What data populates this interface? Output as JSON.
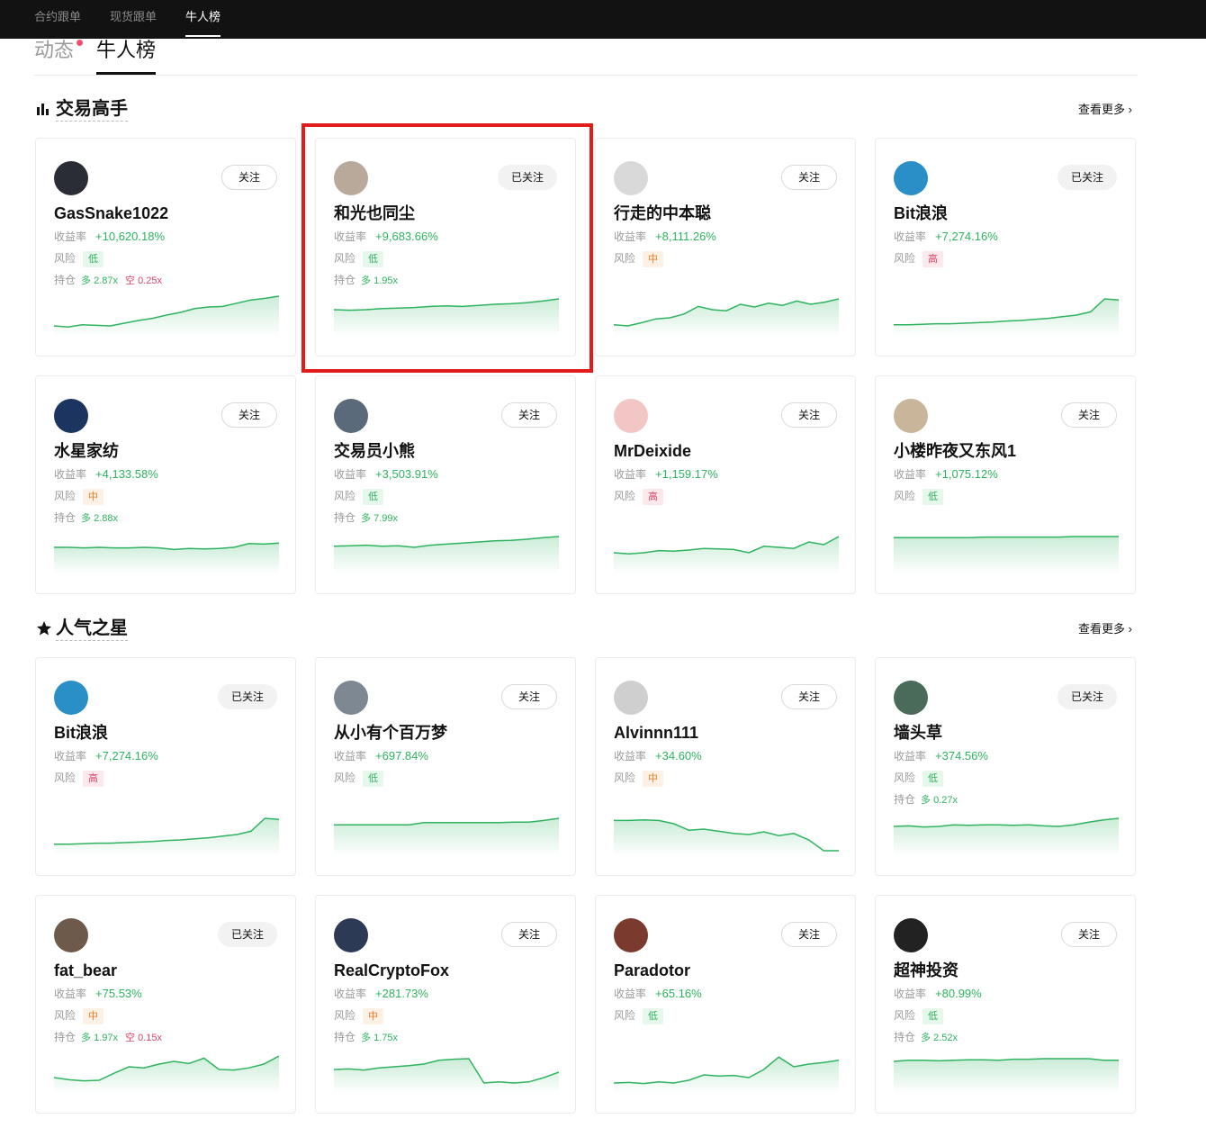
{
  "topnav": [
    {
      "label": "合约跟单",
      "active": false
    },
    {
      "label": "现货跟单",
      "active": false
    },
    {
      "label": "牛人榜",
      "active": true
    }
  ],
  "subtabs": {
    "dynamic": "动态",
    "ranking": "牛人榜"
  },
  "labels": {
    "roi": "收益率",
    "risk": "风险",
    "position": "持仓",
    "long": "多",
    "short": "空"
  },
  "colors": {
    "profit": "#2eb35f",
    "highlight_box": "#e21b1b"
  },
  "sections": [
    {
      "title": "交易高手",
      "icon": "bar-chart-icon",
      "see_more": "查看更多",
      "traders": [
        {
          "name": "GasSnake1022",
          "follow": "关注",
          "followed": false,
          "roi": "+10,620.18%",
          "risk": "低",
          "risk_level": "low",
          "long": "2.87x",
          "short": "0.25x",
          "avatar_icon": "dark-disc-avatar",
          "trend": [
            0.2,
            0.18,
            0.22,
            0.21,
            0.2,
            0.25,
            0.3,
            0.34,
            0.4,
            0.45,
            0.52,
            0.55,
            0.56,
            0.62,
            0.68,
            0.71,
            0.75
          ]
        },
        {
          "name": "和光也同尘",
          "follow": "已关注",
          "followed": true,
          "roi": "+9,683.66%",
          "risk": "低",
          "risk_level": "low",
          "long": "1.95x",
          "short": null,
          "avatar_icon": "person-photo-avatar",
          "trend": [
            0.5,
            0.49,
            0.5,
            0.52,
            0.53,
            0.54,
            0.56,
            0.57,
            0.56,
            0.58,
            0.6,
            0.61,
            0.63,
            0.66,
            0.7
          ]
        },
        {
          "name": "行走的中本聪",
          "follow": "关注",
          "followed": false,
          "roi": "+8,111.26%",
          "risk": "中",
          "risk_level": "mid",
          "long": null,
          "short": null,
          "avatar_icon": "cartoon-panda-avatar",
          "trend": [
            0.22,
            0.2,
            0.26,
            0.33,
            0.35,
            0.42,
            0.56,
            0.5,
            0.48,
            0.6,
            0.55,
            0.62,
            0.58,
            0.66,
            0.6,
            0.64,
            0.7
          ]
        },
        {
          "name": "Bit浪浪",
          "follow": "已关注",
          "followed": true,
          "roi": "+7,274.16%",
          "risk": "高",
          "risk_level": "high",
          "long": null,
          "short": null,
          "avatar_icon": "wave-avatar",
          "trend": [
            0.22,
            0.22,
            0.23,
            0.24,
            0.24,
            0.25,
            0.26,
            0.27,
            0.29,
            0.3,
            0.32,
            0.34,
            0.37,
            0.4,
            0.46,
            0.7,
            0.68
          ]
        }
      ]
    },
    {
      "title": "人气之星",
      "icon": "star-icon",
      "see_more": "查看更多",
      "traders": [
        {
          "name": "Bit浪浪",
          "follow": "已关注",
          "followed": true,
          "roi": "+7,274.16%",
          "risk": "高",
          "risk_level": "high",
          "long": null,
          "short": null,
          "avatar_icon": "wave-avatar",
          "trend": [
            0.22,
            0.22,
            0.23,
            0.24,
            0.24,
            0.25,
            0.26,
            0.27,
            0.29,
            0.3,
            0.32,
            0.34,
            0.37,
            0.4,
            0.46,
            0.7,
            0.68
          ]
        }
      ]
    }
  ],
  "grid_rows": [
    {
      "section": 0,
      "traders": [
        {
          "name": "水星家纺",
          "follow": "关注",
          "followed": false,
          "roi": "+4,133.58%",
          "risk": "中",
          "risk_level": "mid",
          "long": "2.88x",
          "short": null,
          "avatar_icon": "bitcoin-avatar",
          "trend": [
            0.5,
            0.5,
            0.49,
            0.5,
            0.49,
            0.49,
            0.5,
            0.49,
            0.46,
            0.48,
            0.47,
            0.48,
            0.5,
            0.57,
            0.56,
            0.58
          ]
        },
        {
          "name": "交易员小熊",
          "follow": "关注",
          "followed": false,
          "roi": "+3,503.91%",
          "risk": "低",
          "risk_level": "low",
          "long": "7.99x",
          "short": null,
          "avatar_icon": "glasses-person-avatar",
          "trend": [
            0.52,
            0.53,
            0.54,
            0.52,
            0.53,
            0.5,
            0.54,
            0.56,
            0.58,
            0.6,
            0.62,
            0.63,
            0.65,
            0.68,
            0.7
          ]
        },
        {
          "name": "MrDeixide",
          "follow": "关注",
          "followed": false,
          "roi": "+1,159.17%",
          "risk": "高",
          "risk_level": "high",
          "long": null,
          "short": null,
          "avatar_icon": "cartoon-kid-avatar",
          "trend": [
            0.4,
            0.38,
            0.4,
            0.44,
            0.43,
            0.45,
            0.48,
            0.47,
            0.46,
            0.4,
            0.52,
            0.5,
            0.48,
            0.6,
            0.55,
            0.7
          ]
        },
        {
          "name": "小楼昨夜又东风1",
          "follow": "关注",
          "followed": false,
          "roi": "+1,075.12%",
          "risk": "低",
          "risk_level": "low",
          "long": null,
          "short": null,
          "avatar_icon": "glasses-face-avatar",
          "trend": [
            0.68,
            0.68,
            0.68,
            0.68,
            0.68,
            0.68,
            0.69,
            0.69,
            0.69,
            0.69,
            0.69,
            0.69,
            0.7,
            0.7,
            0.7,
            0.7
          ]
        }
      ]
    },
    {
      "section": 1,
      "traders": [
        {
          "name": "从小有个百万梦",
          "follow": "关注",
          "followed": false,
          "roi": "+697.84%",
          "risk": "低",
          "risk_level": "low",
          "long": null,
          "short": null,
          "avatar_icon": "landscape-avatar",
          "trend": [
            0.58,
            0.58,
            0.58,
            0.58,
            0.58,
            0.58,
            0.62,
            0.62,
            0.62,
            0.62,
            0.62,
            0.62,
            0.63,
            0.63,
            0.66,
            0.7
          ]
        },
        {
          "name": "Alvinnn111",
          "follow": "关注",
          "followed": false,
          "roi": "+34.60%",
          "risk": "中",
          "risk_level": "mid",
          "long": null,
          "short": null,
          "avatar_icon": "dancer-avatar",
          "trend": [
            0.66,
            0.66,
            0.67,
            0.66,
            0.6,
            0.48,
            0.5,
            0.46,
            0.42,
            0.4,
            0.45,
            0.38,
            0.42,
            0.3,
            0.1,
            0.1
          ]
        },
        {
          "name": "墙头草",
          "follow": "已关注",
          "followed": true,
          "roi": "+374.56%",
          "risk": "低",
          "risk_level": "low",
          "long": "0.27x",
          "short": null,
          "avatar_icon": "frog-avatar",
          "trend": [
            0.55,
            0.56,
            0.54,
            0.55,
            0.58,
            0.57,
            0.58,
            0.58,
            0.57,
            0.58,
            0.56,
            0.55,
            0.58,
            0.63,
            0.67,
            0.7
          ]
        },
        {
          "name": "fat_bear",
          "follow": "已关注",
          "followed": true,
          "roi": "+75.53%",
          "risk": "中",
          "risk_level": "mid",
          "long": "1.97x",
          "short": "0.15x",
          "avatar_icon": "bear-avatar",
          "trend": [
            0.3,
            0.26,
            0.24,
            0.25,
            0.38,
            0.5,
            0.48,
            0.55,
            0.6,
            0.56,
            0.66,
            0.45,
            0.44,
            0.48,
            0.55,
            0.7
          ]
        },
        {
          "name": "RealCryptoFox",
          "follow": "关注",
          "followed": false,
          "roi": "+281.73%",
          "risk": "中",
          "risk_level": "mid",
          "long": "1.75x",
          "short": null,
          "avatar_icon": "suit-person-avatar",
          "trend": [
            0.45,
            0.46,
            0.44,
            0.48,
            0.5,
            0.52,
            0.55,
            0.62,
            0.64,
            0.65,
            0.2,
            0.22,
            0.2,
            0.22,
            0.3,
            0.4
          ]
        },
        {
          "name": "Paradotor",
          "follow": "关注",
          "followed": false,
          "roi": "+65.16%",
          "risk": "低",
          "risk_level": "low",
          "long": null,
          "short": null,
          "avatar_icon": "bearded-man-avatar",
          "trend": [
            0.2,
            0.21,
            0.19,
            0.22,
            0.2,
            0.25,
            0.35,
            0.33,
            0.34,
            0.3,
            0.45,
            0.68,
            0.5,
            0.55,
            0.58,
            0.62
          ]
        },
        {
          "name": "超神投资",
          "follow": "关注",
          "followed": false,
          "roi": "+80.99%",
          "risk": "低",
          "risk_level": "low",
          "long": "2.52x",
          "short": null,
          "avatar_icon": "car-avatar",
          "trend": [
            0.6,
            0.62,
            0.62,
            0.61,
            0.62,
            0.63,
            0.63,
            0.62,
            0.64,
            0.64,
            0.65,
            0.65,
            0.65,
            0.65,
            0.62,
            0.62
          ]
        }
      ]
    }
  ]
}
